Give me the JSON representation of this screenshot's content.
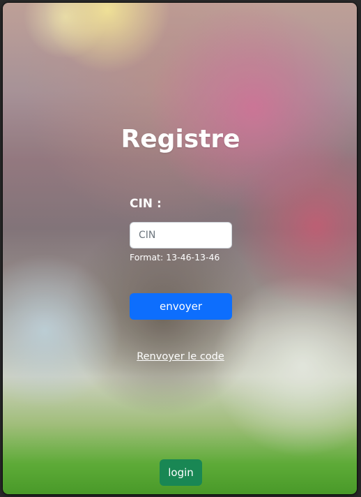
{
  "page": {
    "title": "Registre"
  },
  "form": {
    "cin_label": "CIN :",
    "cin_placeholder": "CIN",
    "cin_value": "",
    "format_hint": "Format: 13-46-13-46",
    "submit_label": "envoyer",
    "resend_label": "Renvoyer le code"
  },
  "footer": {
    "login_label": "login"
  },
  "colors": {
    "primary_button": "#0d6efd",
    "success_button": "#198754",
    "text": "#ffffff"
  }
}
